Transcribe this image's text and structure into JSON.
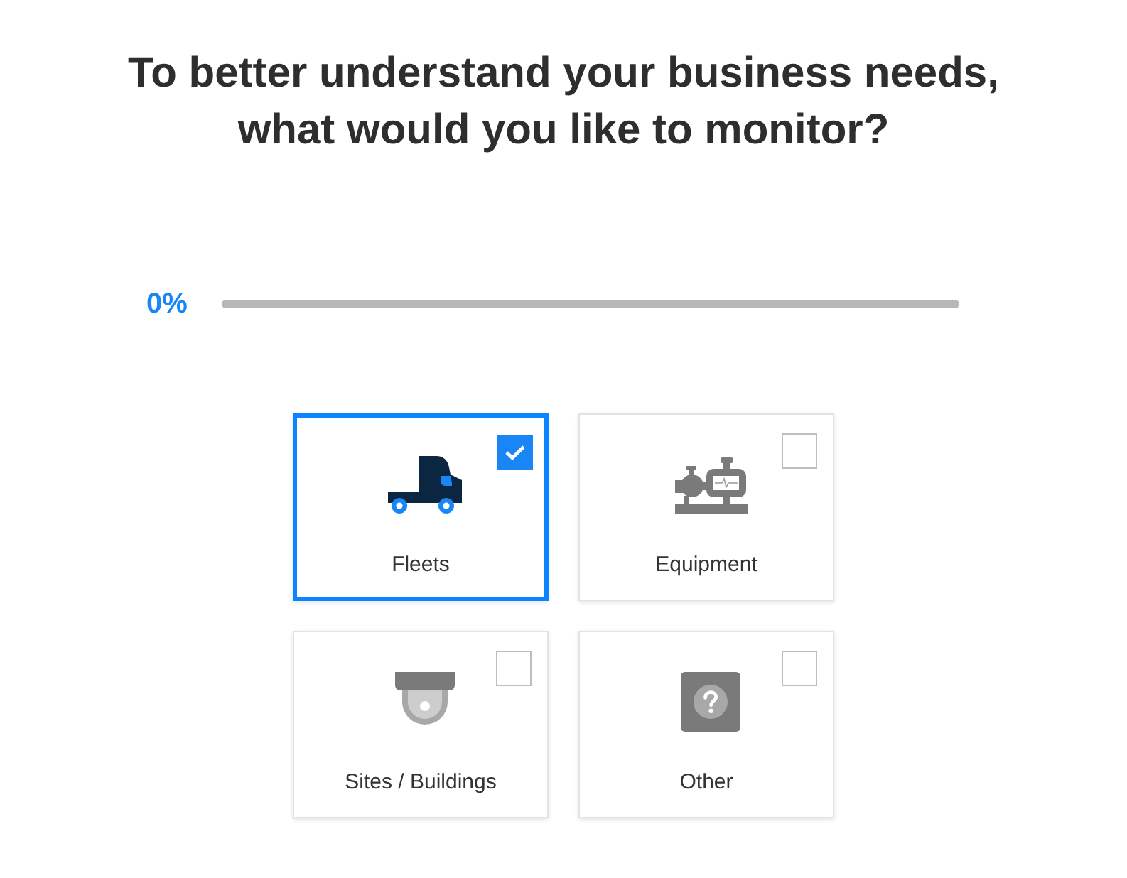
{
  "heading": "To better understand your business needs, what would you like to monitor?",
  "progress": {
    "label": "0%",
    "level": 0
  },
  "options": [
    {
      "label": "Fleets",
      "kind": "truck",
      "selected": true
    },
    {
      "label": "Equipment",
      "kind": "equipment",
      "selected": false
    },
    {
      "label": "Sites / Buildings",
      "kind": "camera",
      "selected": false
    },
    {
      "label": "Other",
      "kind": "other",
      "selected": false
    }
  ]
}
